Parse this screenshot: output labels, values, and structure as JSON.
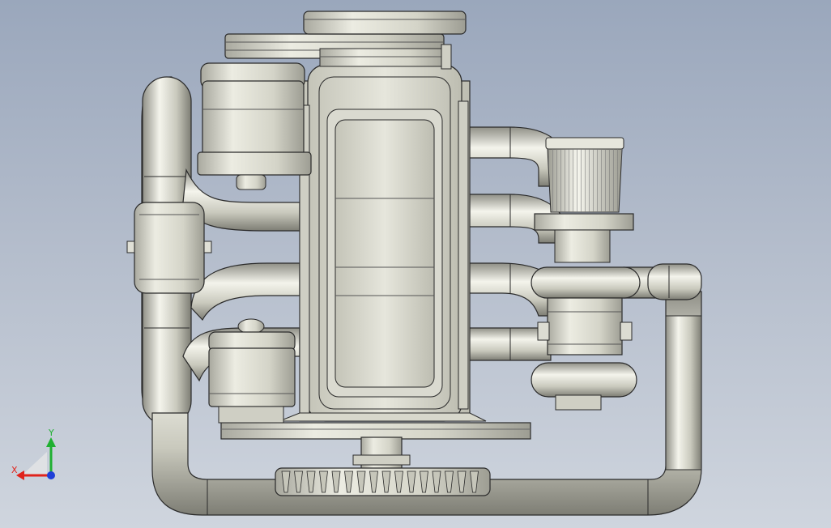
{
  "viewport": {
    "background_top": "#9aa7bc",
    "background_bottom": "#cfd5de"
  },
  "model": {
    "metal_color": "#d8d8cc",
    "edge_color": "#2a2a2a"
  },
  "triad": {
    "x_label": "X",
    "y_label": "Y",
    "x_color": "#e0231c",
    "y_color": "#1fb031",
    "z_color": "#1f3fd8"
  }
}
